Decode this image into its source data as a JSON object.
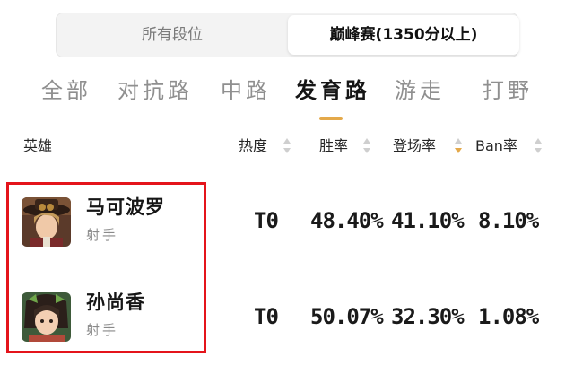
{
  "rank_filter": {
    "options": [
      "所有段位",
      "巅峰赛(1350分以上)"
    ],
    "selected": "巅峰赛(1350分以上)"
  },
  "lanes": {
    "tabs": [
      "全部",
      "对抗路",
      "中路",
      "发育路",
      "游走",
      "打野"
    ],
    "active": "发育路"
  },
  "table": {
    "columns": {
      "hero": "英雄",
      "heat": "热度",
      "win_rate": "胜率",
      "pick_rate": "登场率",
      "ban_rate": "Ban率"
    },
    "sorted_by": "登场率",
    "sort_direction": "descending",
    "rows": [
      {
        "name": "马可波罗",
        "role": "射手",
        "heat": "T0",
        "win_rate": "48.40%",
        "pick_rate": "41.10%",
        "ban_rate": "8.10%"
      },
      {
        "name": "孙尚香",
        "role": "射手",
        "heat": "T0",
        "win_rate": "50.07%",
        "pick_rate": "32.30%",
        "ban_rate": "1.08%"
      }
    ]
  },
  "colors": {
    "accent": "#e4a94a",
    "highlight_border": "#e4141b"
  }
}
